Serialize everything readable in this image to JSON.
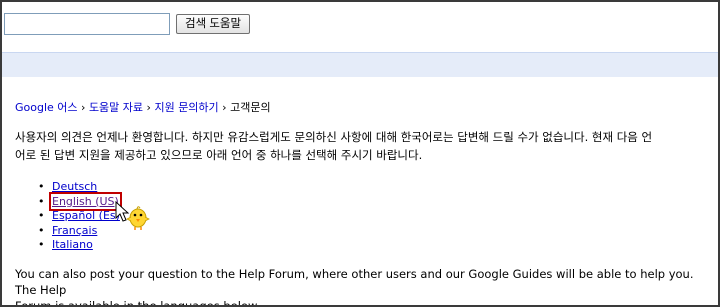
{
  "search": {
    "value": "",
    "button_label": "검색 도움말"
  },
  "breadcrumb": {
    "items": [
      "Google 어스",
      "도움말 자료",
      "지원 문의하기"
    ],
    "current": "고객문의",
    "separator": "›"
  },
  "intro": {
    "line1": "사용자의 의견은 언제나 환영합니다. 하지만 유감스럽게도 문의하신 사항에 대해 한국어로는 답변해 드릴 수가 없습니다. 현재 다음 언",
    "line2": "어로 된 답변 지원을 제공하고 있으므로 아래 언어 중 하나를 선택해 주시기 바랍니다."
  },
  "languages": [
    "Deutsch",
    "English (US)",
    "Español (Es)",
    "Français",
    "Italiano"
  ],
  "selected_language": "English (US)",
  "help_forum": {
    "line1": "You can also post your question to the Help Forum, where other users and our Google Guides will be able to help you. The Help",
    "line2": "Forum is available in the languages below."
  },
  "colors": {
    "link": "#0000cc",
    "visited": "#551a8b",
    "highlight_box": "#c00000",
    "band": "#e5ecf9"
  }
}
